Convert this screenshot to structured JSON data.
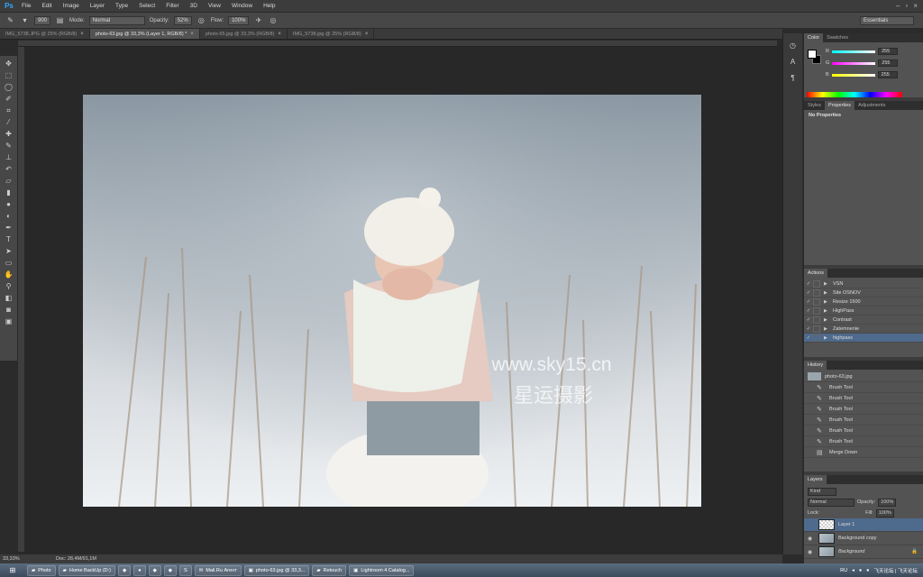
{
  "app": {
    "logo": "Ps"
  },
  "menu": [
    "File",
    "Edit",
    "Image",
    "Layer",
    "Type",
    "Select",
    "Filter",
    "3D",
    "View",
    "Window",
    "Help"
  ],
  "options": {
    "brush_size": "900",
    "mode_label": "Mode:",
    "mode_value": "Normal",
    "opacity_label": "Opacity:",
    "opacity_value": "52%",
    "flow_label": "Flow:",
    "flow_value": "100%",
    "workspace": "Essentials"
  },
  "tabs": [
    {
      "label": "IMG_5738.JPG @ 25% (RGB/8)",
      "active": false
    },
    {
      "label": "photo-63.jpg @ 33,3% (Layer 1, RGB/8) *",
      "active": true
    },
    {
      "label": "photo-65.jpg @ 33,3% (RGB/8)",
      "active": false
    },
    {
      "label": "IMG_5738.jpg @ 25% (RGB/8)",
      "active": false
    }
  ],
  "tab_close": "×",
  "canvas": {
    "watermark_url": "www.sky15.cn",
    "watermark_cn": "星运摄影"
  },
  "status": {
    "zoom": "33,33%",
    "doc": "Doc: 28,4M/91,1M"
  },
  "color_panel": {
    "tabs": [
      "Color",
      "Swatches"
    ],
    "r_label": "R",
    "g_label": "G",
    "b_label": "B",
    "r": "255",
    "g": "255",
    "b": "255"
  },
  "props_panel": {
    "tabs": [
      "Styles",
      "Properties",
      "Adjustments"
    ],
    "content": "No Properties"
  },
  "actions_panel": {
    "title": "Actions",
    "items": [
      "VSN",
      "Site OSNOV",
      "Resize 1500",
      "HighPass",
      "Contrast",
      "Zatemnenie",
      "highpass"
    ]
  },
  "history_panel": {
    "title": "History",
    "snapshot": "photo-63.jpg",
    "items": [
      "Brush Tool",
      "Brush Tool",
      "Brush Tool",
      "Brush Tool",
      "Brush Tool",
      "Brush Tool",
      "Merge Down"
    ]
  },
  "layers_panel": {
    "title": "Layers",
    "kind": "Kind",
    "blend": "Normal",
    "opacity_label": "Opacity:",
    "opacity": "100%",
    "lock_label": "Lock:",
    "fill_label": "Fill:",
    "fill": "100%",
    "layers": [
      "Layer 1",
      "Background copy",
      "Background"
    ]
  },
  "taskbar": {
    "items": [
      "Photo",
      "Home BackUp (D:)",
      "Mail.Ru Агент",
      "photo-63.jpg @ 33,3...",
      "Retouch",
      "Lightroom 4 Catalog..."
    ],
    "lang": "RU",
    "tray_text": "飞天论坛 | 飞天论坛"
  },
  "colors": {
    "accent": "#31a8ff",
    "selection": "#4e6a8c",
    "panel": "#535353",
    "canvas_bg": "#282828"
  }
}
